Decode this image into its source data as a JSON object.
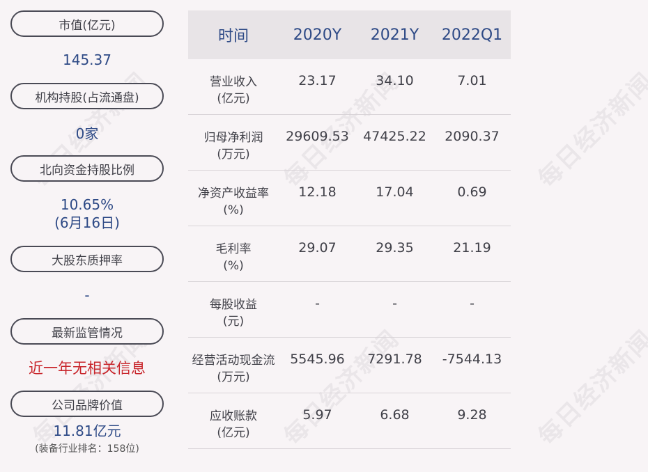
{
  "left_panel": [
    {
      "label": "市值(亿元)",
      "value": "145.37"
    },
    {
      "label": "机构持股(占流通盘)",
      "value": "0家"
    },
    {
      "label": "北向资金持股比例",
      "value": "10.65%",
      "value2": "(6月16日)"
    },
    {
      "label": "大股东质押率",
      "value": "-"
    },
    {
      "label": "最新监管情况",
      "value": "近一年无相关信息",
      "value_color": "#c8252b"
    },
    {
      "label": "公司品牌价值",
      "value": "11.81亿元",
      "note": "(装备行业排名：158位)"
    }
  ],
  "table": {
    "headers": [
      "时间",
      "2020Y",
      "2021Y",
      "2022Q1"
    ],
    "rows": [
      {
        "label": [
          "营业收入",
          "(亿元)"
        ],
        "values": [
          "23.17",
          "34.10",
          "7.01"
        ]
      },
      {
        "label": [
          "归母净利润",
          "(万元)"
        ],
        "values": [
          "29609.53",
          "47425.22",
          "2090.37"
        ]
      },
      {
        "label": [
          "净资产收益率",
          "(%)"
        ],
        "values": [
          "12.18",
          "17.04",
          "0.69"
        ]
      },
      {
        "label": [
          "毛利率",
          "(%)"
        ],
        "values": [
          "29.07",
          "29.35",
          "21.19"
        ]
      },
      {
        "label": [
          "每股收益",
          "(元)"
        ],
        "values": [
          "-",
          "-",
          "-"
        ]
      },
      {
        "label": [
          "经营活动现金流",
          "(万元)"
        ],
        "values": [
          "5545.96",
          "7291.78",
          "-7544.13"
        ]
      },
      {
        "label": [
          "应收账款",
          "(亿元)"
        ],
        "values": [
          "5.97",
          "6.68",
          "9.28"
        ]
      }
    ]
  },
  "watermark": "每日经济新闻",
  "colors": {
    "accent": "#2e4a86",
    "alert": "#c8252b",
    "header_bg": "#e8e4e7",
    "page_bg": "#f8f4f6"
  }
}
